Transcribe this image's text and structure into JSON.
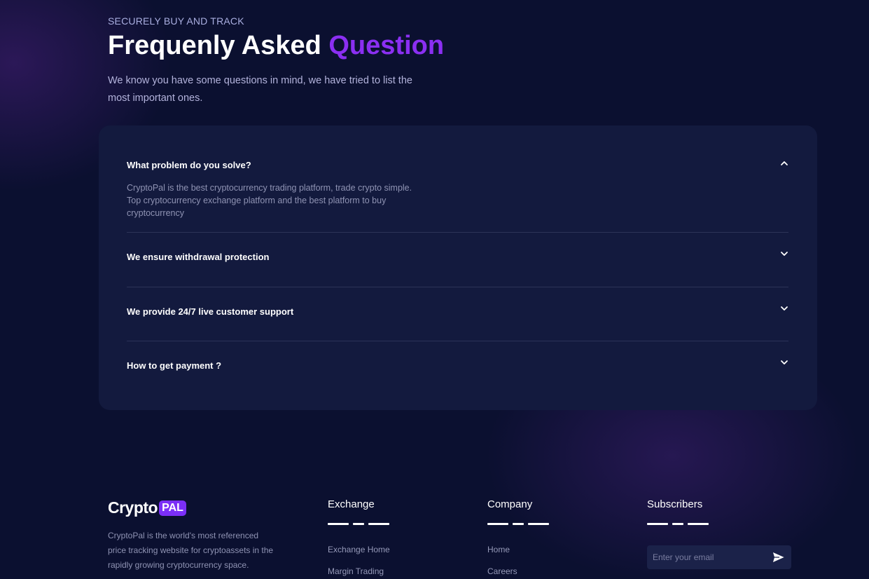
{
  "faq": {
    "eyebrow": "SECURELY BUY AND TRACK",
    "title_main": "Frequenly Asked",
    "title_accent": "Question",
    "subtitle": "We know you have some questions in mind, we have tried to list the most important ones.",
    "items": [
      {
        "question": "What problem do you solve?",
        "answer": "CryptoPal is the best cryptocurrency trading platform, trade crypto simple. Top cryptocurrency exchange platform and the best platform to buy cryptocurrency",
        "expanded": true,
        "icon": "chevron-up-icon"
      },
      {
        "question": "We ensure withdrawal protection",
        "expanded": false,
        "icon": "chevron-down-icon"
      },
      {
        "question": "We provide 24/7 live customer support",
        "expanded": false,
        "icon": "chevron-down-icon"
      },
      {
        "question": "How to get payment ?",
        "expanded": false,
        "icon": "chevron-down-icon"
      }
    ]
  },
  "footer": {
    "logo_text": "Crypto",
    "logo_badge": "PAL",
    "about": "CryptoPal is the world's most referenced price tracking website for cryptoassets in the rapidly growing cryptocurrency space.",
    "exchange": {
      "title": "Exchange",
      "links": [
        "Exchange Home",
        "Margin Trading"
      ]
    },
    "company": {
      "title": "Company",
      "links": [
        "Home",
        "Careers"
      ]
    },
    "subscribers": {
      "title": "Subscribers",
      "email_placeholder": "Enter your email",
      "send_icon": "send-icon"
    }
  },
  "colors": {
    "background": "#0b1030",
    "card": "#131a3e",
    "accent": "#8b2ff2",
    "logo_badge": "#7b2ff7"
  }
}
